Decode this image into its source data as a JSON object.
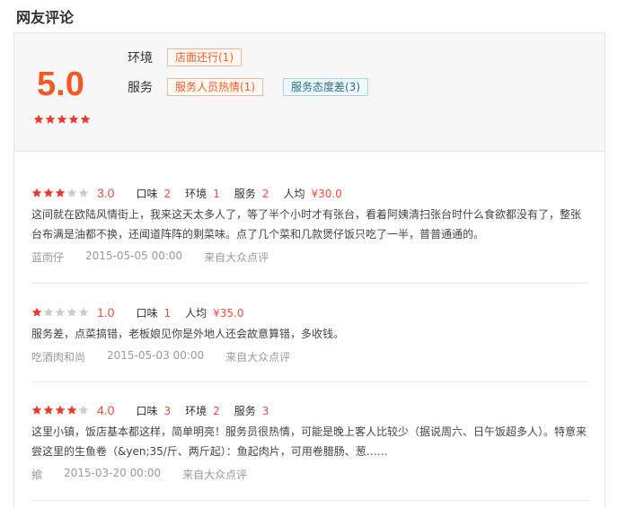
{
  "section_title": "网友评论",
  "summary": {
    "score": "5.0",
    "stars": 5,
    "rows": [
      {
        "label": "环境",
        "tags": [
          {
            "text": "店面还行(1)",
            "type": "pos"
          }
        ]
      },
      {
        "label": "服务",
        "tags": [
          {
            "text": "服务人员热情(1)",
            "type": "pos"
          },
          {
            "text": "服务态度差(3)",
            "type": "neg"
          }
        ]
      }
    ]
  },
  "reviews": [
    {
      "stars": 3,
      "score": "3.0",
      "subs": [
        {
          "label": "口味",
          "value": "2"
        },
        {
          "label": "环境",
          "value": "1"
        },
        {
          "label": "服务",
          "value": "2"
        }
      ],
      "price_label": "人均",
      "price": "¥30.0",
      "text": "这间就在欧陆风情街上，我来这天太多人了，等了半个小时才有张台，看着阿姨清扫张台时什么食欲都没有了，整张台布满是油都不换，还闻道阵阵的剩菜味。点了几个菜和几款煲仔饭只吃了一半，普普通通的。",
      "author": "蓝雨仔",
      "date": "2015-05-05 00:00",
      "source": "来自大众点评"
    },
    {
      "stars": 1,
      "score": "1.0",
      "subs": [
        {
          "label": "口味",
          "value": "1"
        }
      ],
      "price_label": "人均",
      "price": "¥35.0",
      "text": "服务差，点菜搞错，老板娘见你是外地人还会故意算错，多收钱。",
      "author": "吃酒肉和尚",
      "date": "2015-05-03 00:00",
      "source": "来自大众点评"
    },
    {
      "stars": 4,
      "score": "4.0",
      "subs": [
        {
          "label": "口味",
          "value": "3"
        },
        {
          "label": "环境",
          "value": "2"
        },
        {
          "label": "服务",
          "value": "3"
        }
      ],
      "price_label": "",
      "price": "",
      "text": "这里小镇，饭店基本都这样，简单明亮！服务员很热情，可能是晚上客人比较少（据说周六、日午饭超多人）。特意来尝这里的生鱼卷（&yen;35/斤、两斤起）：鱼起肉片，可用卷腊肠、葱……",
      "author": "飨",
      "date": "2015-03-20 00:00",
      "source": "来自大众点评"
    }
  ],
  "colors": {
    "accent": "#f15a22",
    "star_on": "#e8392b",
    "star_off": "#cccccc",
    "neg_tag": "#2b6f8f"
  }
}
